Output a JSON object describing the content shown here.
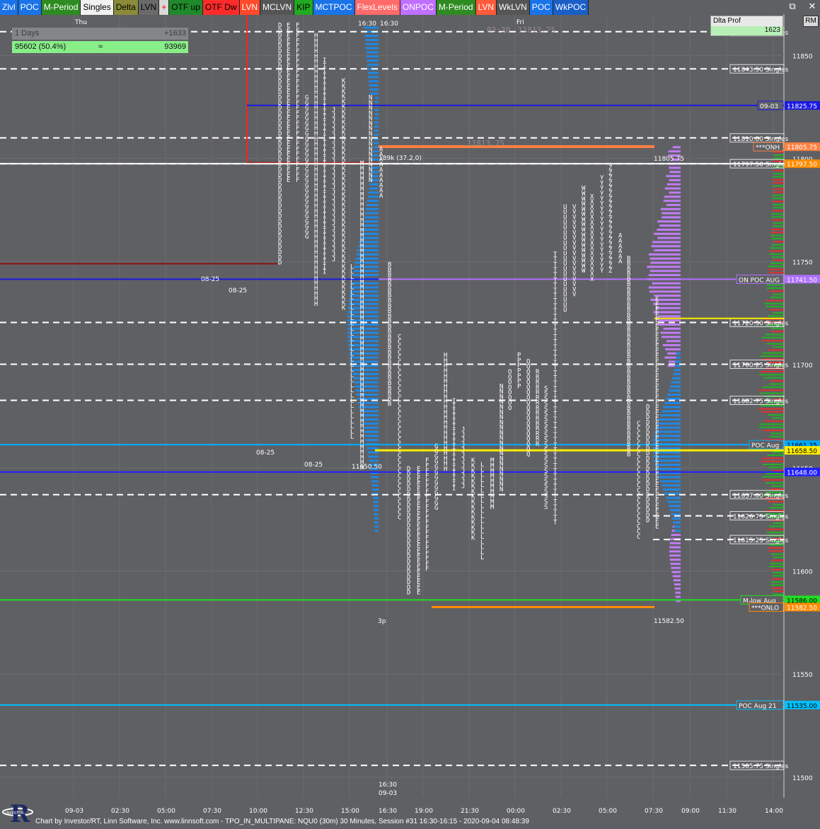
{
  "toolbar": {
    "buttons": [
      {
        "label": "Zlvl",
        "bg": "#1a73e8",
        "fg": "#ffffff"
      },
      {
        "label": "POC",
        "bg": "#1a73e8",
        "fg": "#ffffff"
      },
      {
        "label": "M-Period",
        "bg": "#2e8b22",
        "fg": "#ffffff"
      },
      {
        "label": "Singles",
        "bg": "#f2f2f2",
        "fg": "#000000"
      },
      {
        "label": "Delta",
        "bg": "#8b8b3a",
        "fg": "#000000"
      },
      {
        "label": "LVN",
        "bg": "#6a6a6a",
        "fg": "#000000"
      },
      {
        "label": "+",
        "bg": "#d9d9d9",
        "fg": "#ff0000"
      },
      {
        "label": "OTF up",
        "bg": "#1f8a2a",
        "fg": "#000000"
      },
      {
        "label": "OTF Dw",
        "bg": "#ff2b2b",
        "fg": "#000000"
      },
      {
        "label": "LVN",
        "bg": "#ff4a2b",
        "fg": "#ffffff"
      },
      {
        "label": "MCLVN",
        "bg": "#555555",
        "fg": "#ffffff"
      },
      {
        "label": "KIP",
        "bg": "#22aa22",
        "fg": "#000000"
      },
      {
        "label": "MCTPOC",
        "bg": "#1a73e8",
        "fg": "#ffffff"
      },
      {
        "label": "FlexLevels",
        "bg": "#ff6a6a",
        "fg": "#ffffff"
      },
      {
        "label": "ONPOC",
        "bg": "#c070ff",
        "fg": "#ffffff"
      },
      {
        "label": "M-Period",
        "bg": "#2e8b22",
        "fg": "#ffffff"
      },
      {
        "label": "LVN",
        "bg": "#ff5a3a",
        "fg": "#ffffff"
      },
      {
        "label": "WkLVN",
        "bg": "#555555",
        "fg": "#ffffff"
      },
      {
        "label": "POC",
        "bg": "#1a73e8",
        "fg": "#ffffff"
      },
      {
        "label": "WkPOC",
        "bg": "#1a5fc8",
        "fg": "#ffffff"
      }
    ],
    "right_button": "RM"
  },
  "window_controls": {
    "restore": "⧉",
    "close": "✕"
  },
  "delta_profile_panel": {
    "title": "Dlta Prof",
    "value": "1623"
  },
  "days_panel": {
    "label": "1 Days",
    "delta": "+1633",
    "volume": "95602 (50.4%)",
    "sep": "≈",
    "total": "93969"
  },
  "status_bar": "Chart by Investor/RT, Linn Software, Inc. www.linnsoft.com - TPO_IN_MULTIPANE: NQU0 (30m) 30 Minutes, Session #31 16:30-16:15 - 2020-09-04 08:48:39",
  "logo_text": "INVESTOR",
  "logo_letter": "R",
  "chart_data": {
    "type": "tpo-profile",
    "symbol": "NQU0",
    "ylim": [
      11490,
      11870
    ],
    "y_ticks": [
      11850,
      11800,
      11750,
      11700,
      11650,
      11600,
      11550,
      11500
    ],
    "x_ticks": [
      "09-03",
      "02:30",
      "05:00",
      "07:30",
      "10:00",
      "12:30",
      "15:00",
      "16:30",
      "19:00",
      "21:30",
      "00:00",
      "02:30",
      "05:00",
      "07:30",
      "09:00",
      "11:30",
      "14:00"
    ],
    "day_labels": [
      {
        "text": "Thu",
        "tick": 0
      },
      {
        "text": "Fri",
        "tick": 10
      }
    ],
    "axis_text": {
      "p1": "16:30",
      "p2": "16:30",
      "sess1": "16:30",
      "sess2": "09-03",
      "three_p": "3p",
      "top_time": "03:30",
      "top_price": "11813.75",
      "mid_price": "11813.75",
      "stat": "189k (37.2,0)",
      "hi_label": "11805.75",
      "lo_label": "11582.50",
      "mark_0825a": "08-25",
      "mark_0825b": "08-25",
      "mark_0825c": "08-25",
      "mark_0825d": "08-25",
      "low_label": "11650.50"
    },
    "singles": [
      11861.5,
      11843.5,
      11810.0,
      11797.5,
      11720.5,
      11700.25,
      11682.75,
      11637.0,
      11626.75,
      11615.25,
      11505.75
    ],
    "levels": [
      {
        "name": "09-03",
        "price": 11825.75,
        "color": "#1a1ae0",
        "label": "11825.75",
        "tag": "09-03",
        "tagbg": "#1a1ae0"
      },
      {
        "name": "ONH",
        "price": 11805.75,
        "color": "#ff8040",
        "label": "11805.75",
        "tag": "***ONH",
        "tagbg": "#ff8040"
      },
      {
        "name": "Singles 11797.50",
        "price": 11797.5,
        "color": "#ffffff",
        "label": "11797.50",
        "tag": "",
        "tagbg": "#ff8c00"
      },
      {
        "name": "ON POC Aug",
        "price": 11741.5,
        "color": "#b070ff",
        "label": "11741.50",
        "tag": "ON POC AUG",
        "tagbg": "#b070ff"
      },
      {
        "name": "POC Aug",
        "price": 11661.25,
        "color": "#00aaff",
        "label": "11661.25",
        "tag": "POC Aug",
        "tagbg": "#00aaff"
      },
      {
        "name": "yellow",
        "price": 11658.5,
        "color": "#ffee00",
        "label": "11658.50",
        "tag": "",
        "tagbg": "#ffee00"
      },
      {
        "name": "blue",
        "price": 11648.0,
        "color": "#2020ff",
        "label": "11648.00",
        "tag": "",
        "tagbg": "#2020ff"
      },
      {
        "name": "M-low Aug",
        "price": 11586.0,
        "color": "#22dd22",
        "label": "11586.00",
        "tag": "M-low Aug",
        "tagbg": "#22dd22"
      },
      {
        "name": "ONLO",
        "price": 11582.5,
        "color": "#ff8c00",
        "label": "11582.50",
        "tag": "***ONLO",
        "tagbg": "#ff8c00"
      },
      {
        "name": "POC Aug 21",
        "price": 11535.0,
        "color": "#00c0ff",
        "label": "11535.00",
        "tag": "POC Aug 21",
        "tagbg": "#00c0ff"
      }
    ],
    "tpo_columns": [
      {
        "letter": "D",
        "x": 393,
        "top": 11865,
        "bottom": 11748
      },
      {
        "letter": "E",
        "x": 405,
        "top": 11865,
        "bottom": 11790
      },
      {
        "letter": "F",
        "x": 418,
        "top": 11865,
        "bottom": 11790
      },
      {
        "letter": "G",
        "x": 431,
        "top": 11830,
        "bottom": 11762
      },
      {
        "letter": "H",
        "x": 444,
        "top": 11860,
        "bottom": 11730
      },
      {
        "letter": "I",
        "x": 456,
        "top": 11848,
        "bottom": 11745
      },
      {
        "letter": "J",
        "x": 469,
        "top": 11824,
        "bottom": 11750
      },
      {
        "letter": "K",
        "x": 483,
        "top": 11838,
        "bottom": 11728
      },
      {
        "letter": "L",
        "x": 495,
        "top": 11748,
        "bottom": 11665
      },
      {
        "letter": "M",
        "x": 509,
        "top": 11798,
        "bottom": 11650
      },
      {
        "letter": "N",
        "x": 521,
        "top": 11830,
        "bottom": 11790
      },
      {
        "letter": "A",
        "x": 536,
        "top": 11805,
        "bottom": 11782
      },
      {
        "letter": "B",
        "x": 548,
        "top": 11749,
        "bottom": 11680
      },
      {
        "letter": "C",
        "x": 562,
        "top": 11714,
        "bottom": 11625
      },
      {
        "letter": "D",
        "x": 575,
        "top": 11650,
        "bottom": 11590
      },
      {
        "letter": "E",
        "x": 589,
        "top": 11650,
        "bottom": 11590
      },
      {
        "letter": "F",
        "x": 601,
        "top": 11654,
        "bottom": 11600
      },
      {
        "letter": "G",
        "x": 614,
        "top": 11661,
        "bottom": 11630
      },
      {
        "letter": "H",
        "x": 627,
        "top": 11705,
        "bottom": 11650
      },
      {
        "letter": "I",
        "x": 639,
        "top": 11683,
        "bottom": 11640
      },
      {
        "letter": "J",
        "x": 652,
        "top": 11669,
        "bottom": 11641
      },
      {
        "letter": "K",
        "x": 666,
        "top": 11654,
        "bottom": 11615
      },
      {
        "letter": "L",
        "x": 679,
        "top": 11652,
        "bottom": 11605
      },
      {
        "letter": "M",
        "x": 693,
        "top": 11654,
        "bottom": 11630
      },
      {
        "letter": "N",
        "x": 706,
        "top": 11690,
        "bottom": 11640
      },
      {
        "letter": "O",
        "x": 718,
        "top": 11697,
        "bottom": 11679
      },
      {
        "letter": "P",
        "x": 731,
        "top": 11705,
        "bottom": 11690
      },
      {
        "letter": "Q",
        "x": 744,
        "top": 11702,
        "bottom": 11656
      },
      {
        "letter": "R",
        "x": 757,
        "top": 11697,
        "bottom": 11660
      },
      {
        "letter": "S",
        "x": 769,
        "top": 11689,
        "bottom": 11630
      },
      {
        "letter": "T",
        "x": 782,
        "top": 11754,
        "bottom": 11622
      },
      {
        "letter": "U",
        "x": 796,
        "top": 11777,
        "bottom": 11727
      },
      {
        "letter": "V",
        "x": 809,
        "top": 11777,
        "bottom": 11734
      },
      {
        "letter": "W",
        "x": 822,
        "top": 11786,
        "bottom": 11744
      },
      {
        "letter": "X",
        "x": 834,
        "top": 11782,
        "bottom": 11740
      },
      {
        "letter": "Y",
        "x": 848,
        "top": 11791,
        "bottom": 11744
      },
      {
        "letter": "Z",
        "x": 860,
        "top": 11796,
        "bottom": 11745
      },
      {
        "letter": "A",
        "x": 874,
        "top": 11763,
        "bottom": 11750
      },
      {
        "letter": "B",
        "x": 886,
        "top": 11752,
        "bottom": 11655
      },
      {
        "letter": "C",
        "x": 900,
        "top": 11672,
        "bottom": 11617
      },
      {
        "letter": "D",
        "x": 913,
        "top": 11680,
        "bottom": 11625
      },
      {
        "letter": "E",
        "x": 926,
        "top": 11732,
        "bottom": 11620
      }
    ]
  }
}
